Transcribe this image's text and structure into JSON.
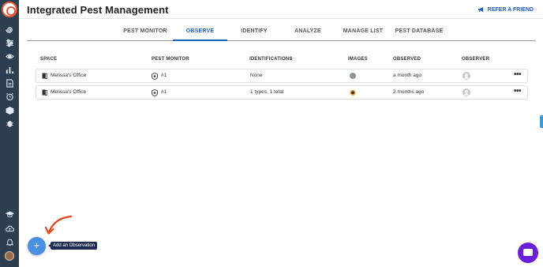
{
  "app": {
    "title": "Integrated Pest Management",
    "refer_label": "REFER A FRIEND",
    "accent_color": "#1f5fbf",
    "sidebar_color": "#2c3e50"
  },
  "sidebar": {
    "top_icons": [
      "spiral-icon",
      "sliders-icon",
      "eye-icon",
      "bar-chart-icon",
      "document-icon",
      "alarm-icon",
      "box-icon",
      "bug-icon"
    ],
    "bottom_icons": [
      "graduation-cap-icon",
      "cloud-upload-icon",
      "bell-icon",
      "user-avatar"
    ]
  },
  "tabs": [
    {
      "label": "PEST MONITOR",
      "active": false
    },
    {
      "label": "OBSERVE",
      "active": true
    },
    {
      "label": "IDENTIFY",
      "active": false
    },
    {
      "label": "ANALYZE",
      "active": false
    },
    {
      "label": "MANAGE LIST",
      "active": false
    },
    {
      "label": "PEST DATABASE",
      "active": false
    }
  ],
  "table": {
    "columns": [
      "SPACE",
      "PEST MONITOR",
      "IDENTIFICATIONS",
      "IMAGES",
      "OBSERVED",
      "OBSERVER"
    ],
    "rows": [
      {
        "space": "Melissa's Office",
        "pest_monitor": "#1",
        "identifications": "None",
        "observed": "a month ago",
        "image_icon": "insect-thumbnail"
      },
      {
        "space": "Melissa's Office",
        "pest_monitor": "#1",
        "identifications": "1 types, 1 total",
        "observed": "2 months ago",
        "image_icon": "insect-thumbnail"
      }
    ],
    "row_menu_label": "•••"
  },
  "fab": {
    "label": "+",
    "tooltip": "Add an Observation",
    "color": "#4a90e2"
  },
  "chat_color": "#6a1fd6"
}
